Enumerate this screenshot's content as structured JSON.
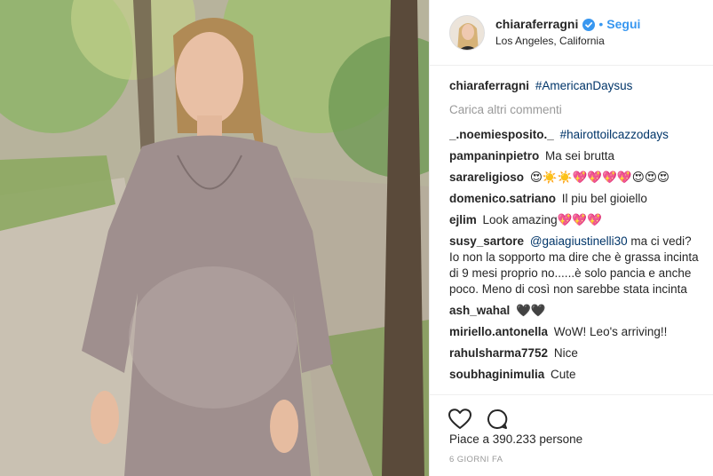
{
  "post": {
    "username": "chiaraferragni",
    "follow_label": "Segui",
    "separator": "•",
    "location": "Los Angeles, California"
  },
  "caption": {
    "username": "chiaraferragni",
    "text": "#AmericanDaysus"
  },
  "load_more_label": "Carica altri commenti",
  "comments": [
    {
      "username": "_.noemiesposito._",
      "text": "#hairottoilcazzodays"
    },
    {
      "username": "pampaninpietro",
      "text": "Ma sei brutta"
    },
    {
      "username": "sarareligioso",
      "text": "😍☀️☀️💖💖💖💖😍😍😍"
    },
    {
      "username": "domenico.satriano",
      "text": "Il piu bel gioiello"
    },
    {
      "username": "ejlim",
      "text": "Look amazing💖💖💖"
    },
    {
      "username": "susy_sartore",
      "mention": "@gaiagiustinelli30",
      "text": " ma ci vedi? Io non la sopporto ma dire che è grassa incinta di 9 mesi proprio no......è solo pancia e anche poco. Meno di così non sarebbe stata incinta"
    },
    {
      "username": "ash_wahal",
      "text": "🖤🖤"
    },
    {
      "username": "miriello.antonella",
      "text": "WoW! Leo's arriving!!"
    },
    {
      "username": "rahulsharma7752",
      "text": "Nice"
    },
    {
      "username": "soubhaginimulia",
      "text": "Cute"
    }
  ],
  "likes_text": "Piace a 390.233 persone",
  "time_text": "6 GIORNI FA",
  "icons": {
    "like": "heart-icon",
    "comment": "comment-bubble-icon",
    "verified": "verified-badge-icon"
  },
  "colors": {
    "link": "#3897f0",
    "hashtag": "#003569",
    "muted": "#999999"
  }
}
